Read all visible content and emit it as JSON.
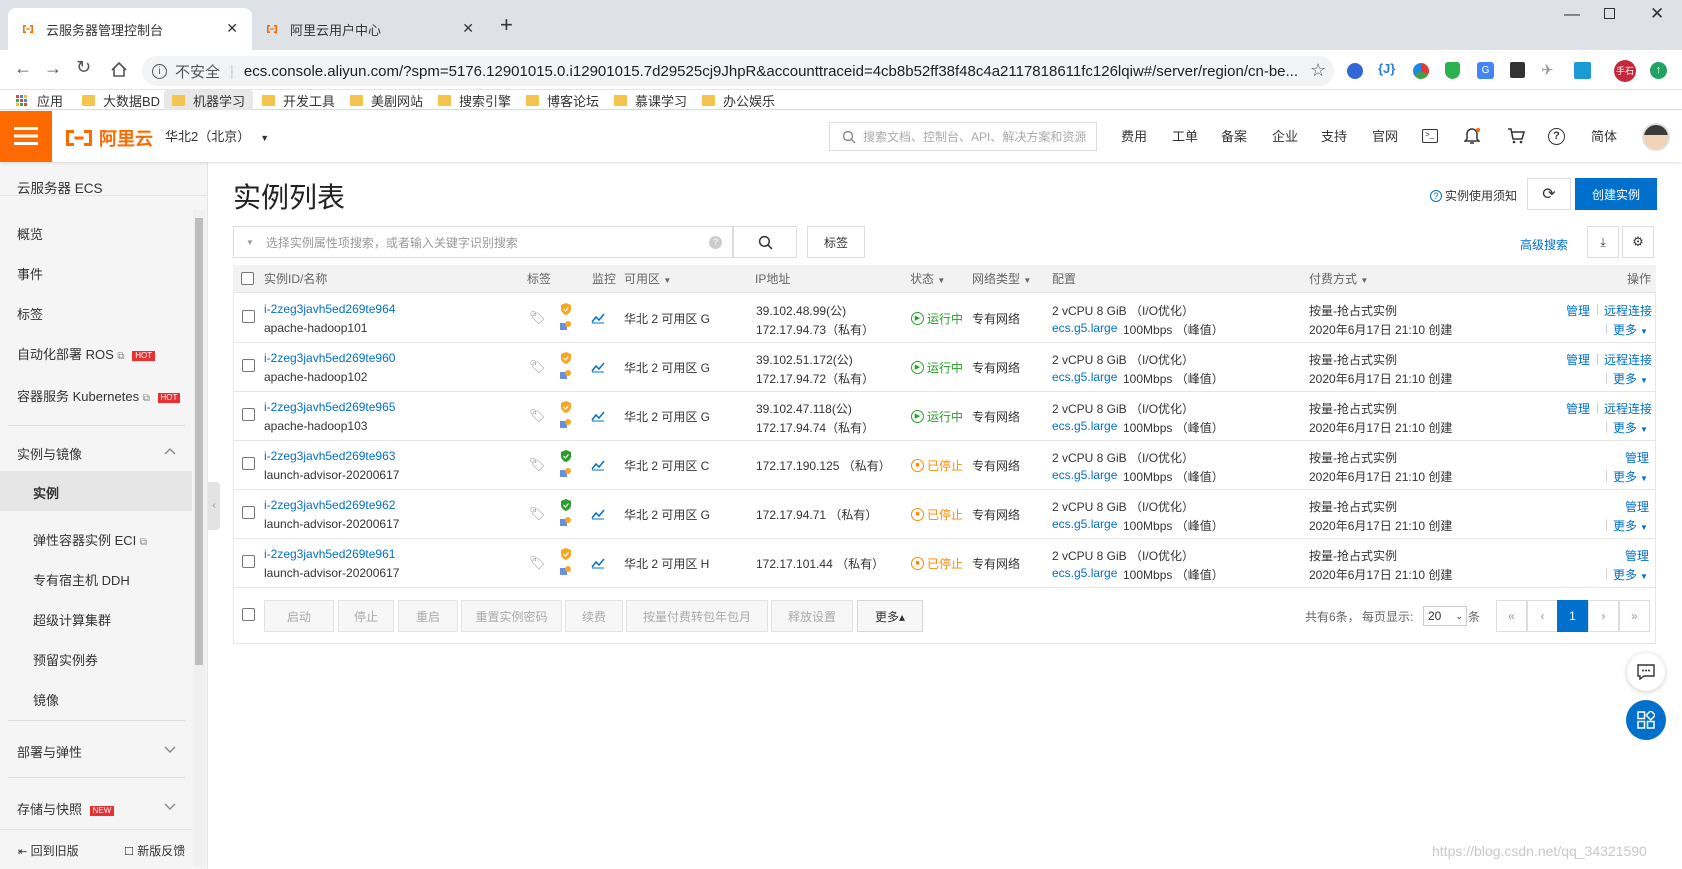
{
  "browser": {
    "tabs": [
      {
        "title": "云服务器管理控制台",
        "active": true
      },
      {
        "title": "阿里云用户中心",
        "active": false
      }
    ],
    "security_label": "不安全",
    "url": "ecs.console.aliyun.com/?spm=5176.12901015.0.i12901015.7d29525cj9JhpR&accounttraceid=4cb8b52ff38f48c4a2117818611fc126lqiw#/server/region/cn-be...",
    "profile_label": "手石",
    "bookmarks": [
      "应用",
      "大数据BD",
      "机器学习",
      "开发工具",
      "美剧网站",
      "搜索引擎",
      "博客论坛",
      "慕课学习",
      "办公娱乐"
    ]
  },
  "header": {
    "logo_text": "阿里云",
    "region": "华北2（北京）",
    "search_placeholder": "搜索文档、控制台、API、解决方案和资源",
    "links": [
      "费用",
      "工单",
      "备案",
      "企业",
      "支持",
      "官网"
    ],
    "lang": "简体"
  },
  "sidebar": {
    "title": "云服务器 ECS",
    "top_items": [
      "概览",
      "事件",
      "标签",
      "自动化部署 ROS",
      "容器服务 Kubernetes"
    ],
    "hot_label": "HOT",
    "new_label": "NEW",
    "group1": "实例与镜像",
    "group1_items": [
      "实例",
      "弹性容器实例 ECI",
      "专有宿主机 DDH",
      "超级计算集群",
      "预留实例券",
      "镜像"
    ],
    "group2": "部署与弹性",
    "group3": "存储与快照",
    "footer_left": "回到旧版",
    "footer_right": "新版反馈"
  },
  "page": {
    "title": "实例列表",
    "notice_link": "实例使用须知",
    "create_button": "创建实例",
    "search_placeholder": "选择实例属性项搜索，或者输入关键字识别搜索",
    "tag_button": "标签",
    "advanced_search": "高级搜索"
  },
  "table": {
    "headers": [
      "实例ID/名称",
      "标签",
      "监控",
      "可用区",
      "IP地址",
      "状态",
      "网络类型",
      "配置",
      "付费方式",
      "操作"
    ],
    "rows": [
      {
        "id": "i-2zeg3javh5ed269te964",
        "name": "apache-hadoop101",
        "zone": "华北 2 可用区 G",
        "ip_public": "39.102.48.99(公)",
        "ip_private": "172.17.94.73（私有）",
        "status": "运行中",
        "net": "专有网络",
        "cpu": "2 vCPU 8 GiB （I/O优化）",
        "spec": "ecs.g5.large",
        "bw": "100Mbps （峰值）",
        "pay": "按量-抢占式实例",
        "created": "2020年6月17日 21:10 创建",
        "ops": [
          "管理",
          "远程连接",
          "更多"
        ]
      },
      {
        "id": "i-2zeg3javh5ed269te960",
        "name": "apache-hadoop102",
        "zone": "华北 2 可用区 G",
        "ip_public": "39.102.51.172(公)",
        "ip_private": "172.17.94.72（私有）",
        "status": "运行中",
        "net": "专有网络",
        "cpu": "2 vCPU 8 GiB （I/O优化）",
        "spec": "ecs.g5.large",
        "bw": "100Mbps （峰值）",
        "pay": "按量-抢占式实例",
        "created": "2020年6月17日 21:10 创建",
        "ops": [
          "管理",
          "远程连接",
          "更多"
        ]
      },
      {
        "id": "i-2zeg3javh5ed269te965",
        "name": "apache-hadoop103",
        "zone": "华北 2 可用区 G",
        "ip_public": "39.102.47.118(公)",
        "ip_private": "172.17.94.74（私有）",
        "status": "运行中",
        "net": "专有网络",
        "cpu": "2 vCPU 8 GiB （I/O优化）",
        "spec": "ecs.g5.large",
        "bw": "100Mbps （峰值）",
        "pay": "按量-抢占式实例",
        "created": "2020年6月17日 21:10 创建",
        "ops": [
          "管理",
          "远程连接",
          "更多"
        ]
      },
      {
        "id": "i-2zeg3javh5ed269te963",
        "name": "launch-advisor-20200617",
        "zone": "华北 2 可用区 C",
        "ip_public": "",
        "ip_private": "172.17.190.125 （私有）",
        "status": "已停止",
        "net": "专有网络",
        "cpu": "2 vCPU 8 GiB （I/O优化）",
        "spec": "ecs.g5.large",
        "bw": "100Mbps （峰值）",
        "pay": "按量-抢占式实例",
        "created": "2020年6月17日 21:10 创建",
        "ops": [
          "管理",
          "",
          "更多"
        ]
      },
      {
        "id": "i-2zeg3javh5ed269te962",
        "name": "launch-advisor-20200617",
        "zone": "华北 2 可用区 G",
        "ip_public": "",
        "ip_private": "172.17.94.71 （私有）",
        "status": "已停止",
        "net": "专有网络",
        "cpu": "2 vCPU 8 GiB （I/O优化）",
        "spec": "ecs.g5.large",
        "bw": "100Mbps （峰值）",
        "pay": "按量-抢占式实例",
        "created": "2020年6月17日 21:10 创建",
        "ops": [
          "管理",
          "",
          "更多"
        ]
      },
      {
        "id": "i-2zeg3javh5ed269te961",
        "name": "launch-advisor-20200617",
        "zone": "华北 2 可用区 H",
        "ip_public": "",
        "ip_private": "172.17.101.44 （私有）",
        "status": "已停止",
        "net": "专有网络",
        "cpu": "2 vCPU 8 GiB （I/O优化）",
        "spec": "ecs.g5.large",
        "bw": "100Mbps （峰值）",
        "pay": "按量-抢占式实例",
        "created": "2020年6月17日 21:10 创建",
        "ops": [
          "管理",
          "",
          "更多"
        ]
      }
    ]
  },
  "footer": {
    "batch_buttons": [
      "启动",
      "停止",
      "重启",
      "重置实例密码",
      "续费",
      "按量付费转包年包月",
      "释放设置",
      "更多▴"
    ],
    "total": "共有6条，",
    "per_page_label": "每页显示:",
    "per_page": "20",
    "per_page_unit": "条",
    "current_page": "1"
  },
  "watermark": "https://blog.csdn.net/qq_34321590",
  "colors": {
    "accent": "#0070cc",
    "brand": "#ff6a00",
    "running": "#25a026",
    "stopped": "#ff8800"
  }
}
